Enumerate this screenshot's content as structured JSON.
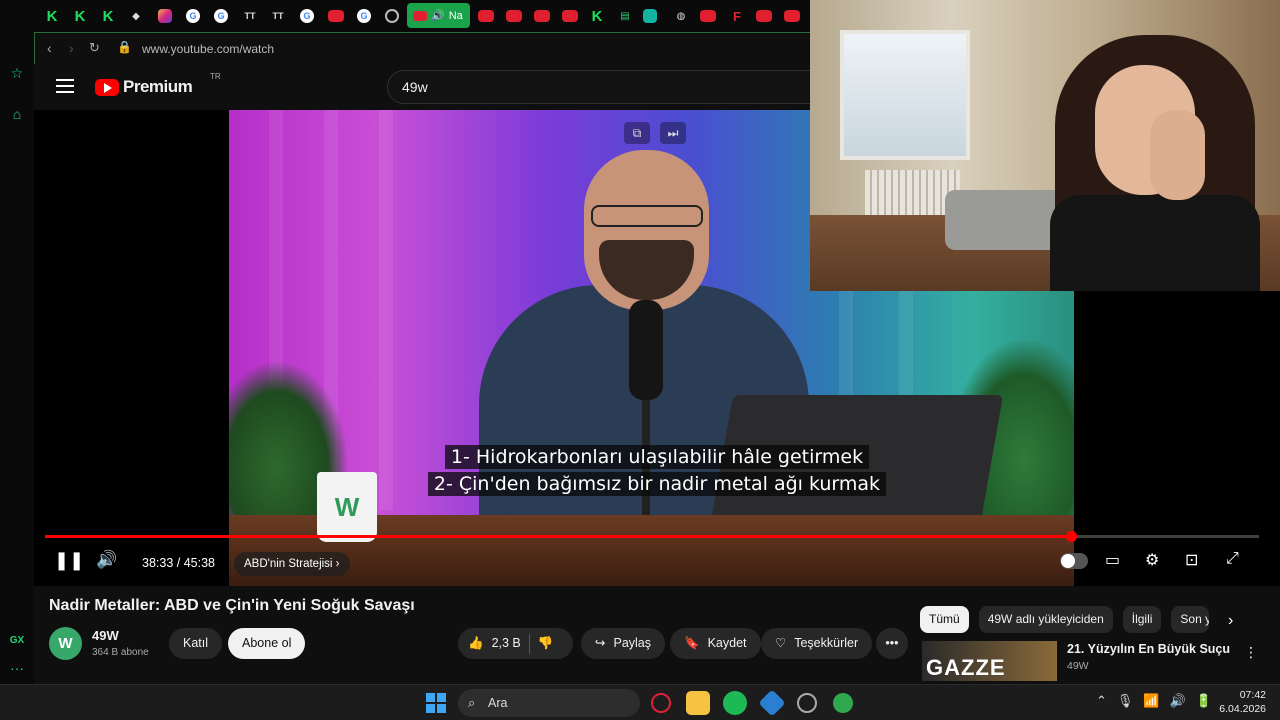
{
  "browser": {
    "url": "www.youtube.com/watch",
    "active_tab_label": "Na",
    "tabs": [
      {
        "icon": "kick-icon",
        "label": "K"
      },
      {
        "icon": "kick-icon",
        "label": "K"
      },
      {
        "icon": "kick-icon",
        "label": "K"
      },
      {
        "icon": "extension-icon",
        "label": ""
      },
      {
        "icon": "instagram-icon",
        "label": ""
      },
      {
        "icon": "google-icon",
        "label": "G"
      },
      {
        "icon": "google-icon",
        "label": "G"
      },
      {
        "icon": "tiktok-icon",
        "label": "TT"
      },
      {
        "icon": "tiktok-icon",
        "label": "TT"
      },
      {
        "icon": "google-icon",
        "label": "G"
      },
      {
        "icon": "youtube-icon",
        "label": ""
      },
      {
        "icon": "google-icon",
        "label": "G"
      },
      {
        "icon": "whatsapp-icon",
        "label": ""
      }
    ],
    "tabs_right": [
      {
        "icon": "youtube-icon",
        "label": ""
      },
      {
        "icon": "youtube-icon",
        "label": ""
      },
      {
        "icon": "youtube-icon",
        "label": ""
      },
      {
        "icon": "youtube-icon",
        "label": ""
      },
      {
        "icon": "youtube-icon",
        "label": ""
      },
      {
        "icon": "kick-icon",
        "label": "K"
      },
      {
        "icon": "document-icon",
        "label": ""
      },
      {
        "icon": "app-icon",
        "label": ""
      },
      {
        "icon": "github-icon",
        "label": ""
      },
      {
        "icon": "youtube-icon",
        "label": ""
      },
      {
        "icon": "youtube-icon",
        "label": ""
      },
      {
        "icon": "f-icon",
        "label": "F"
      },
      {
        "icon": "youtube-icon",
        "label": ""
      },
      {
        "icon": "youtube-icon",
        "label": ""
      }
    ],
    "sidebar_labels": {
      "gx": "GX",
      "more": "···"
    }
  },
  "youtube": {
    "logo_text": "Premium",
    "country_code": "TR",
    "search_query": "49w",
    "player": {
      "captions": [
        "1- Hidrokarbonları ulaşılabilir hâle getirmek",
        "2- Çin'den bağımsız bir nadir metal ağı kurmak"
      ],
      "current_time": "38:33",
      "duration": "45:38",
      "time_display": "38:33 / 45:38",
      "progress_fraction": 0.845,
      "chapter": "ABD'nin Stratejisi",
      "mug_logo": "W"
    },
    "video_title": "Nadir Metaller: ABD ve Çin'in Yeni Soğuk Savaşı",
    "channel": {
      "name": "49W",
      "subscribers": "364 B abone",
      "avatar_letter": "W",
      "join_label": "Katıl",
      "subscribe_label": "Abone ol"
    },
    "actions": {
      "likes": "2,3 B",
      "share": "Paylaş",
      "save": "Kaydet",
      "thanks": "Teşekkürler"
    },
    "chips": [
      "Tümü",
      "49W adlı yükleyiciden",
      "İlgili",
      "Son y"
    ],
    "recommendation": {
      "thumb_text": "GAZZE",
      "title": "21. Yüzyılın En Büyük Suçu",
      "channel": "49W"
    }
  },
  "taskbar": {
    "search_placeholder": "Ara",
    "time": "07:42",
    "date": "6.04.2026"
  },
  "colors": {
    "accent_red": "#ff0000",
    "opera_green": "#21d27a",
    "yt_bg": "#0f0f0f"
  }
}
